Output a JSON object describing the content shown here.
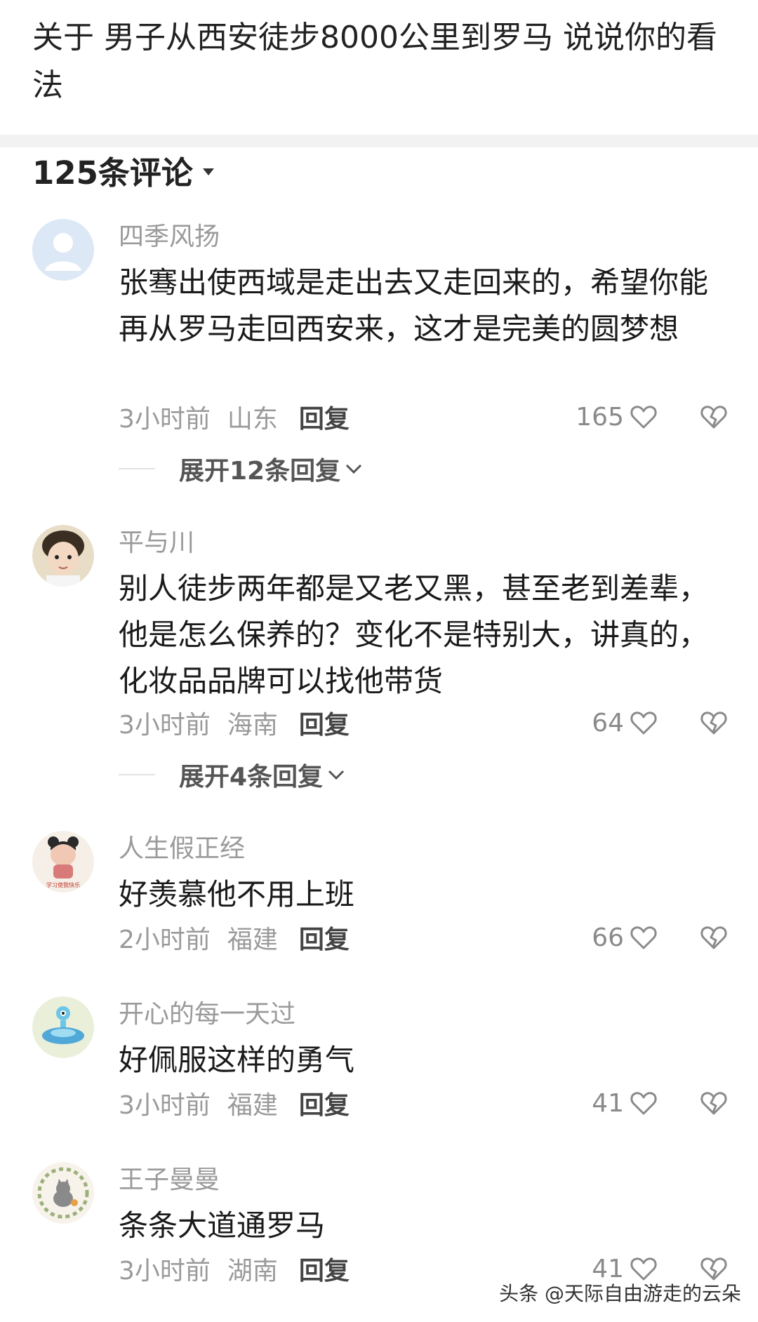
{
  "topic": {
    "title": "关于 男子从西安徒步8000公里到罗马 说说你的看法"
  },
  "comments_header": {
    "count_label": "125条评论"
  },
  "reply_label": "回复",
  "comments": [
    {
      "username": "四季风扬",
      "text": "张骞出使西域是走出去又走回来的，希望你能再从罗马走回西安来，这才是完美的圆梦想",
      "time": "3小时前",
      "location": "山东",
      "likes": "165",
      "expand_label": "展开12条回复",
      "avatar": "default-user-avatar"
    },
    {
      "username": "平与川",
      "text": "别人徒步两年都是又老又黑，甚至老到差辈，他是怎么保养的？变化不是特别大，讲真的，化妆品品牌可以找他带货",
      "time": "3小时前",
      "location": "海南",
      "likes": "64",
      "expand_label": "展开4条回复",
      "avatar": "child-photo-avatar"
    },
    {
      "username": "人生假正经",
      "text": "好羡慕他不用上班",
      "time": "2小时前",
      "location": "福建",
      "likes": "66",
      "avatar": "cartoon-girl-avatar",
      "avatar_caption": "学习使我快乐"
    },
    {
      "username": "开心的每一天过",
      "text": "好佩服这样的勇气",
      "time": "3小时前",
      "location": "福建",
      "likes": "41",
      "avatar": "ufo-cartoon-avatar"
    },
    {
      "username": "王子曼曼",
      "text": "条条大道通罗马",
      "time": "3小时前",
      "location": "湖南",
      "likes": "41",
      "avatar": "cat-wreath-avatar"
    }
  ],
  "watermark": "头条 @天际自由游走的云朵",
  "colors": {
    "muted_text": "#9a9a9a",
    "body_text": "#1a1a1a",
    "divider": "#f2f2f2"
  }
}
